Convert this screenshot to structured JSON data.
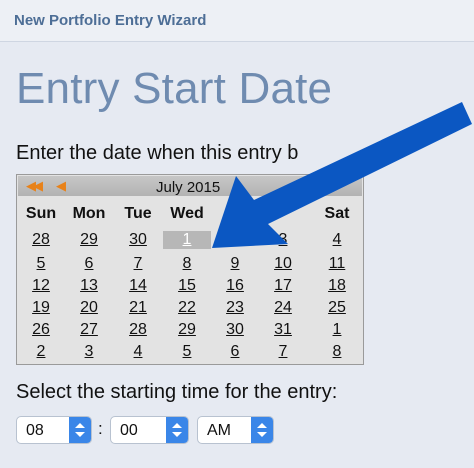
{
  "window": {
    "title": "New Portfolio Entry Wizard"
  },
  "page": {
    "heading": "Entry Start Date",
    "date_instruction": "Enter the date when this entry b",
    "time_instruction": "Select the starting time for the entry:"
  },
  "calendar": {
    "nav_prev_year": "◀◀",
    "nav_prev_month": "◀",
    "month_label": "July 2015",
    "weekdays": [
      "Sun",
      "Mon",
      "Tue",
      "Wed",
      "T",
      "",
      "Sat"
    ],
    "weeks": [
      [
        "28",
        "29",
        "30",
        "1",
        "2",
        "3",
        "4"
      ],
      [
        "5",
        "6",
        "7",
        "8",
        "9",
        "10",
        "11"
      ],
      [
        "12",
        "13",
        "14",
        "15",
        "16",
        "17",
        "18"
      ],
      [
        "19",
        "20",
        "21",
        "22",
        "23",
        "24",
        "25"
      ],
      [
        "26",
        "27",
        "28",
        "29",
        "30",
        "31",
        "1"
      ],
      [
        "2",
        "3",
        "4",
        "5",
        "6",
        "7",
        "8"
      ]
    ],
    "selected_day": "1"
  },
  "time": {
    "hour": "08",
    "separator": ":",
    "minute": "00",
    "meridiem": "AM"
  },
  "colors": {
    "arrow": "#0b57c2",
    "header_text": "#4d6e96",
    "heading_text": "#6f8bb0",
    "stepper": "#3a86e8",
    "nav_arrows": "#e8821a"
  }
}
